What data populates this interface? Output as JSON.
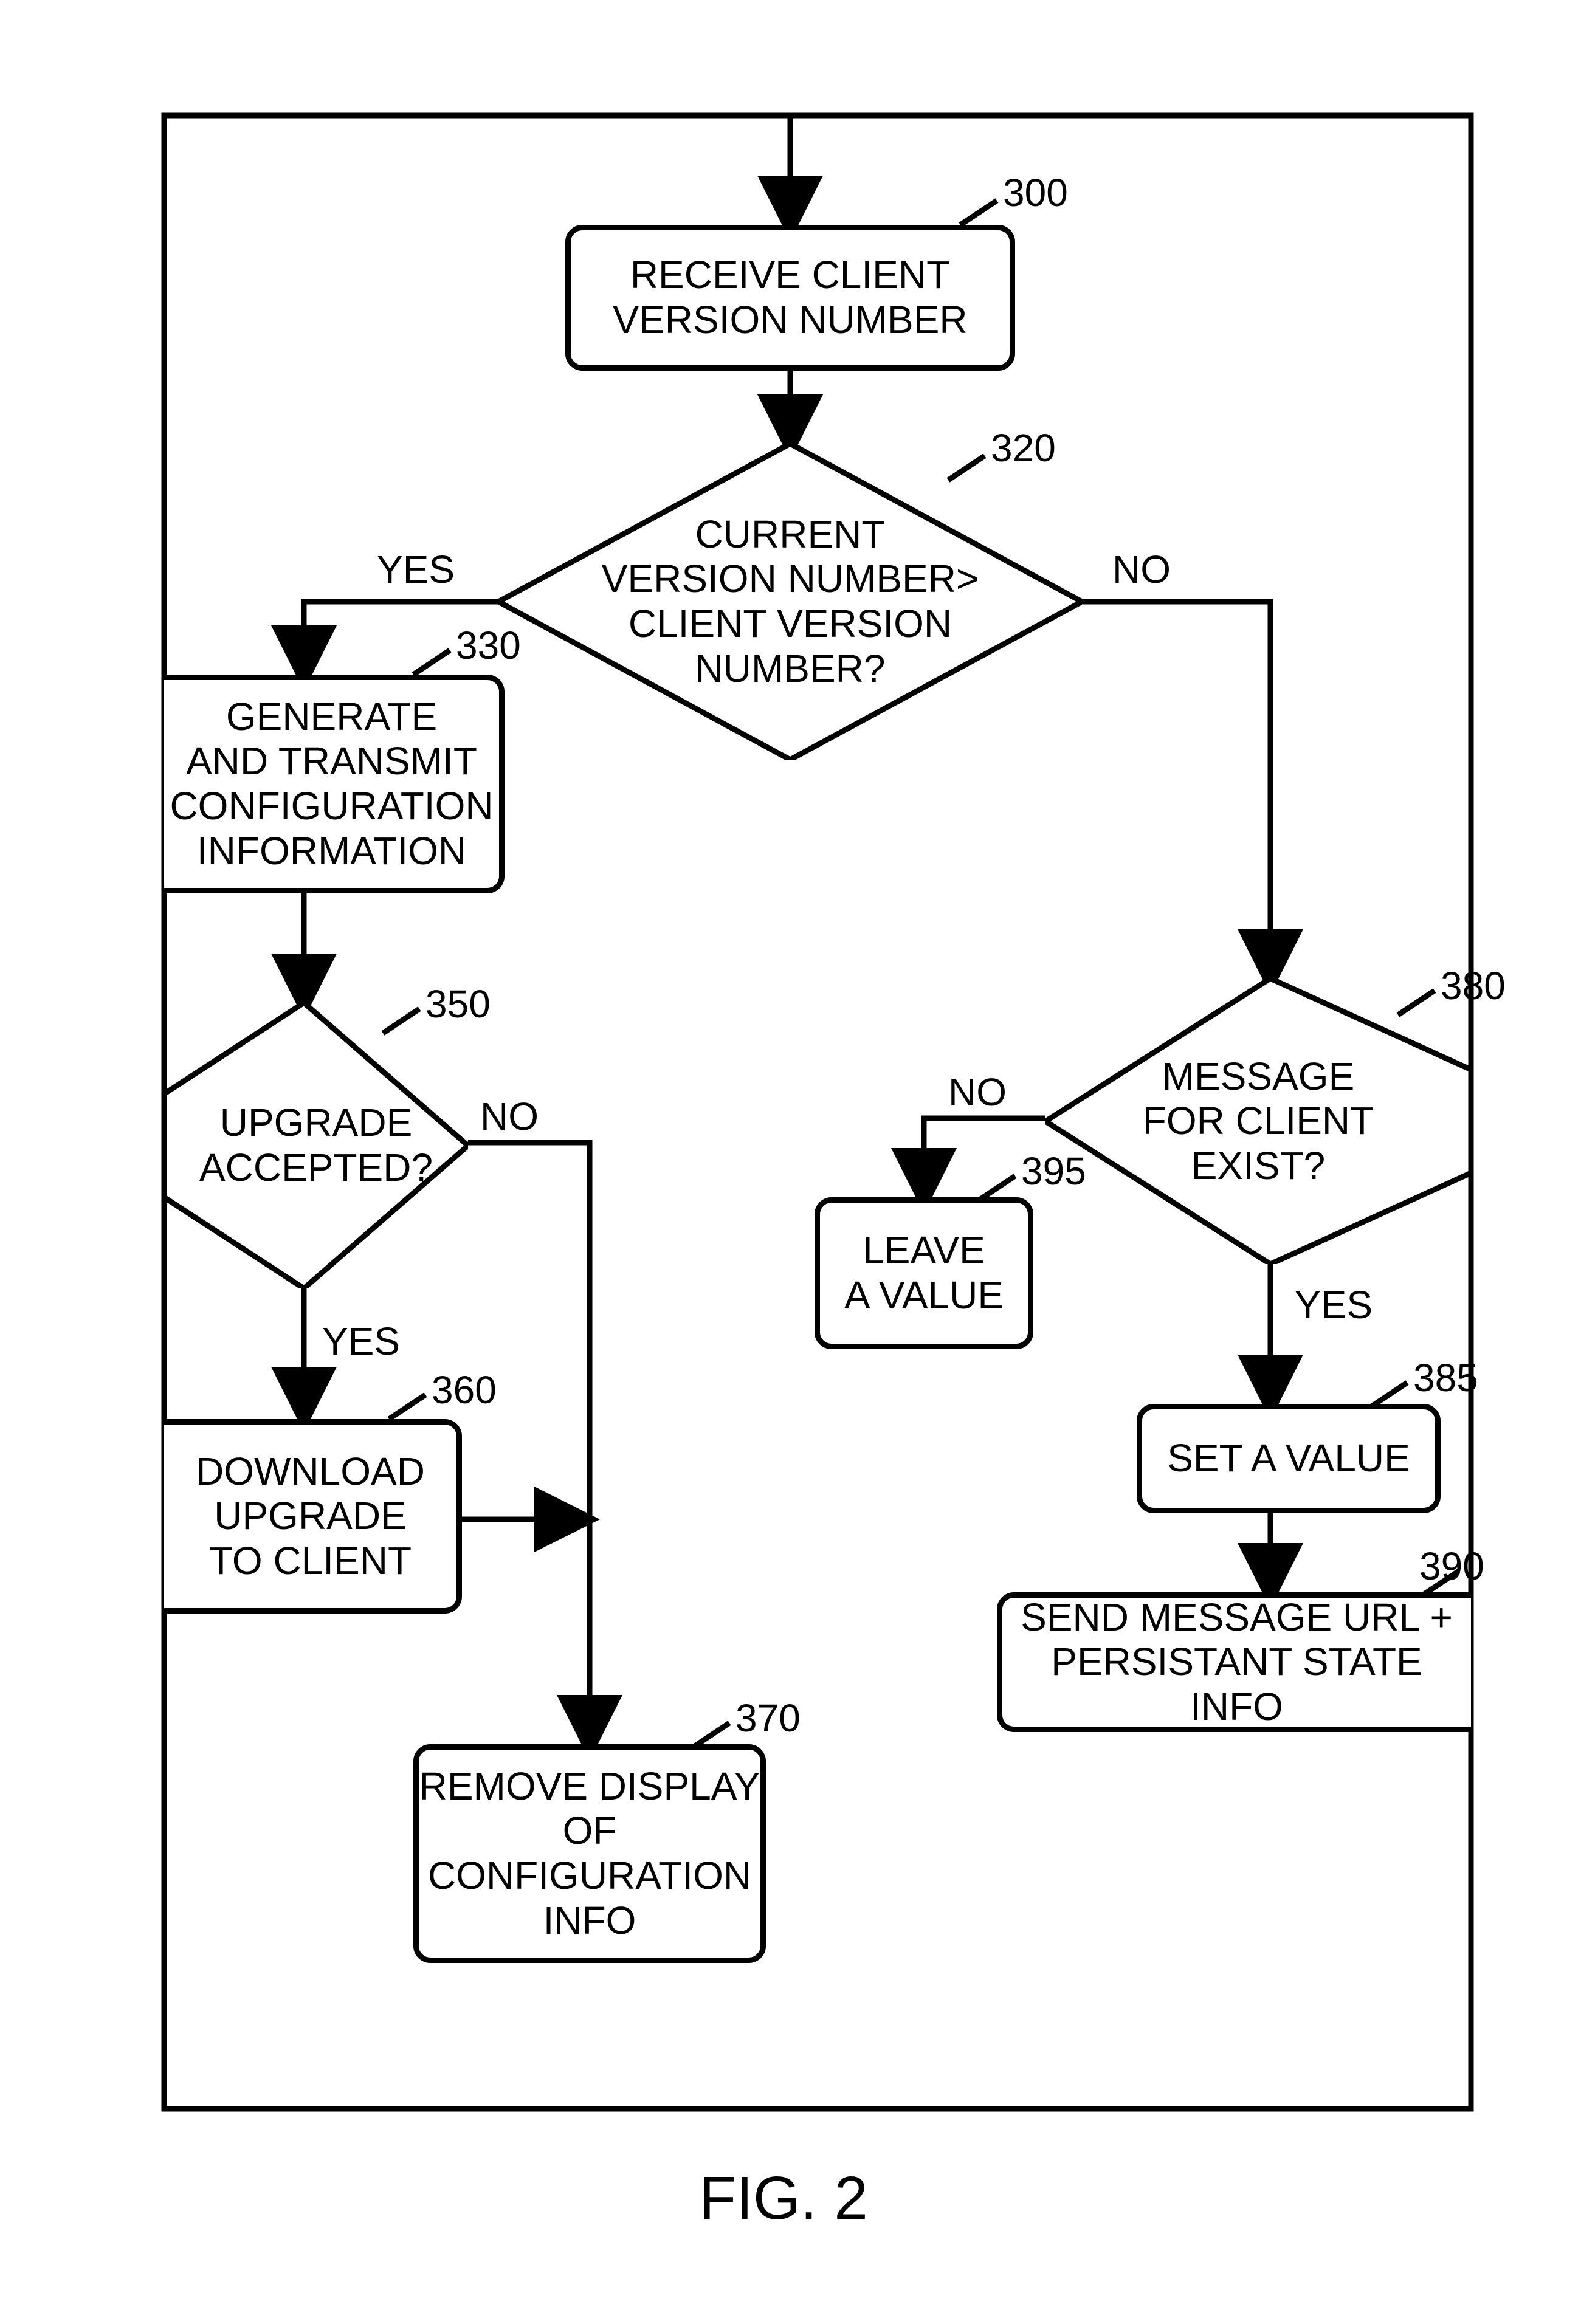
{
  "figure_label": "FIG. 2",
  "refs": {
    "n300": "300",
    "n320": "320",
    "n330": "330",
    "n350": "350",
    "n360": "360",
    "n370": "370",
    "n380": "380",
    "n385": "385",
    "n390": "390",
    "n395": "395"
  },
  "nodes": {
    "n300": "RECEIVE CLIENT\nVERSION NUMBER",
    "n320": "CURRENT\nVERSION NUMBER>\nCLIENT VERSION\nNUMBER?",
    "n330": "GENERATE\nAND TRANSMIT\nCONFIGURATION\nINFORMATION",
    "n350": "UPGRADE\nACCEPTED?",
    "n360": "DOWNLOAD\nUPGRADE\nTO CLIENT",
    "n370": "REMOVE DISPLAY\nOF\nCONFIGURATION\nINFO",
    "n380": "MESSAGE\nFOR CLIENT\nEXIST?",
    "n385": "SET A VALUE",
    "n390": "SEND MESSAGE URL +\nPERSISTANT STATE INFO",
    "n395": "LEAVE\nA VALUE"
  },
  "edge_labels": {
    "yes": "YES",
    "no": "NO"
  }
}
